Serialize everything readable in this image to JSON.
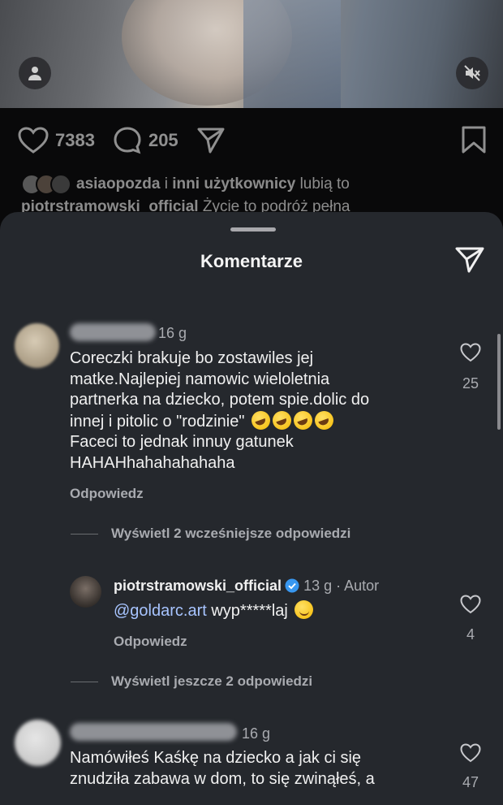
{
  "post": {
    "likes": "7383",
    "comments": "205",
    "liked_by_user": "asiaopozda",
    "liked_by_rest": " i ",
    "liked_by_others": "inni użytkownicy",
    "liked_by_suffix": " lubią to",
    "caption_user": "piotrstramowski_official",
    "caption_text": " Życie to podróż pełna"
  },
  "sheet": {
    "title": "Komentarze"
  },
  "comments": [
    {
      "time": "16 g",
      "text_lines": [
        "Coreczki brakuje bo zostawiles jej",
        "matke.Najlepiej namowic wieloletnia",
        "partnerka na dziecko, potem spie.dolic do",
        "innej i pitolic o \"rodzinie\" ",
        "Faceci to jednak innuy gatunek",
        "HAHAHhahahahahaha"
      ],
      "reply_label": "Odpowiedz",
      "likes": "25",
      "view_more": "Wyświetl 2 wcześniejsze odpowiedzi"
    },
    {
      "username": "piotrstramowski_official",
      "time": "13 g",
      "separator": " · ",
      "author_badge": "Autor",
      "mention": "@goldarc.art",
      "text": " wyp*****laj ",
      "reply_label": "Odpowiedz",
      "likes": "4",
      "view_more": "Wyświetl jeszcze 2 odpowiedzi"
    },
    {
      "time": "16 g",
      "text_lines": [
        "Namówiłeś Kaśkę na dziecko a jak ci się",
        "znudziła zabawa w dom, to się zwinąłeś, a"
      ],
      "likes": "47"
    }
  ],
  "colors": {
    "sheet_bg": "#25282d",
    "secondary_text": "#a9abb0",
    "mention": "#a7c4ff",
    "verified": "#3897f0"
  },
  "icons": [
    "user-icon",
    "mute-icon",
    "heart-icon",
    "comment-icon",
    "send-icon",
    "bookmark-icon",
    "verified-icon"
  ]
}
